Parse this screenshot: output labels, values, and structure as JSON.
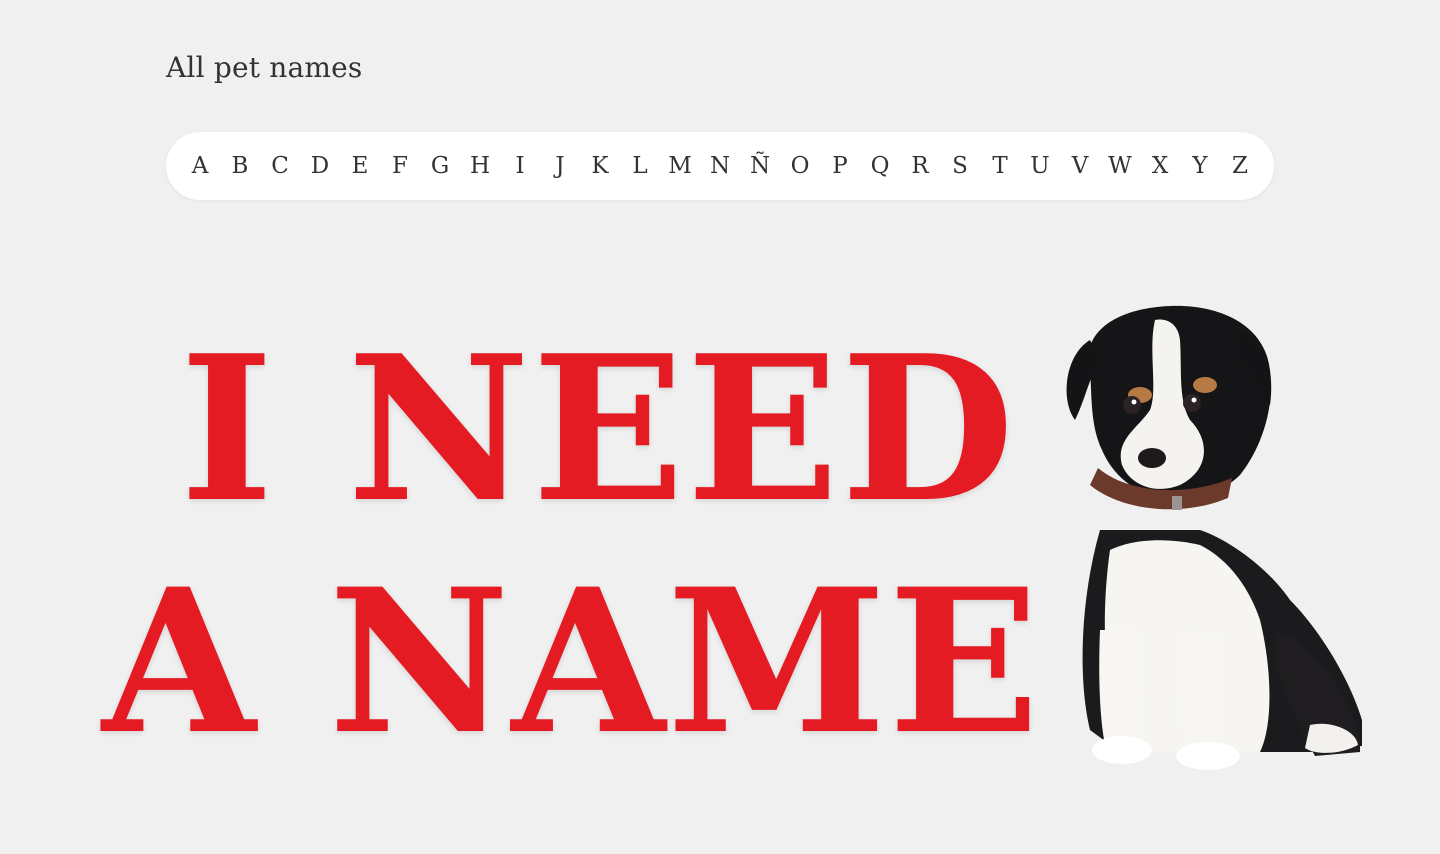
{
  "header": {
    "all_link_label": "All pet names"
  },
  "alphabet": [
    "A",
    "B",
    "C",
    "D",
    "E",
    "F",
    "G",
    "H",
    "I",
    "J",
    "K",
    "L",
    "M",
    "N",
    "Ñ",
    "O",
    "P",
    "Q",
    "R",
    "S",
    "T",
    "U",
    "V",
    "W",
    "X",
    "Y",
    "Z"
  ],
  "hero": {
    "line1": "I NEED",
    "line2": "A NAME",
    "color": "#e41b23"
  },
  "image": {
    "subject": "puppy-image"
  }
}
